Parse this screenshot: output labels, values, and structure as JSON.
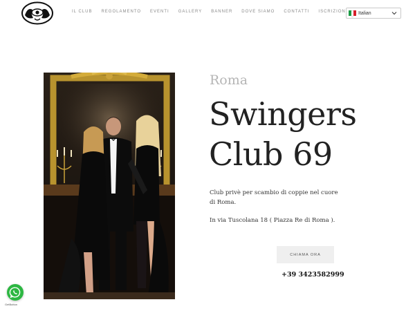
{
  "header": {
    "nav": [
      "IL CLUB",
      "REGOLAMENTO",
      "EVENTI",
      "GALLERY",
      "BANNER",
      "DOVE SIAMO",
      "CONTATTI",
      "ISCRIZIONE"
    ],
    "language": "Italian"
  },
  "hero": {
    "city": "Roma",
    "title_line1": "Swingers",
    "title_line2": "Club 69",
    "description": "Club privè per scambio di coppie nel cuore di Roma.",
    "address": "In via Tuscolana 18 ( Piazza Re di Roma ).",
    "call_button": "CHIAMA ORA",
    "phone": "+39 3423582999"
  },
  "widget": {
    "credit": "GetButton"
  },
  "colors": {
    "whatsapp_green": "#2db742",
    "nav_gray": "#8a8a8a",
    "city_gray": "#b5b5b5",
    "button_bg": "#efefef"
  },
  "icons": {
    "logo": "club-logo-eye",
    "flag": "italy-flag",
    "dropdown": "chevron-down",
    "whatsapp": "whatsapp-icon"
  }
}
